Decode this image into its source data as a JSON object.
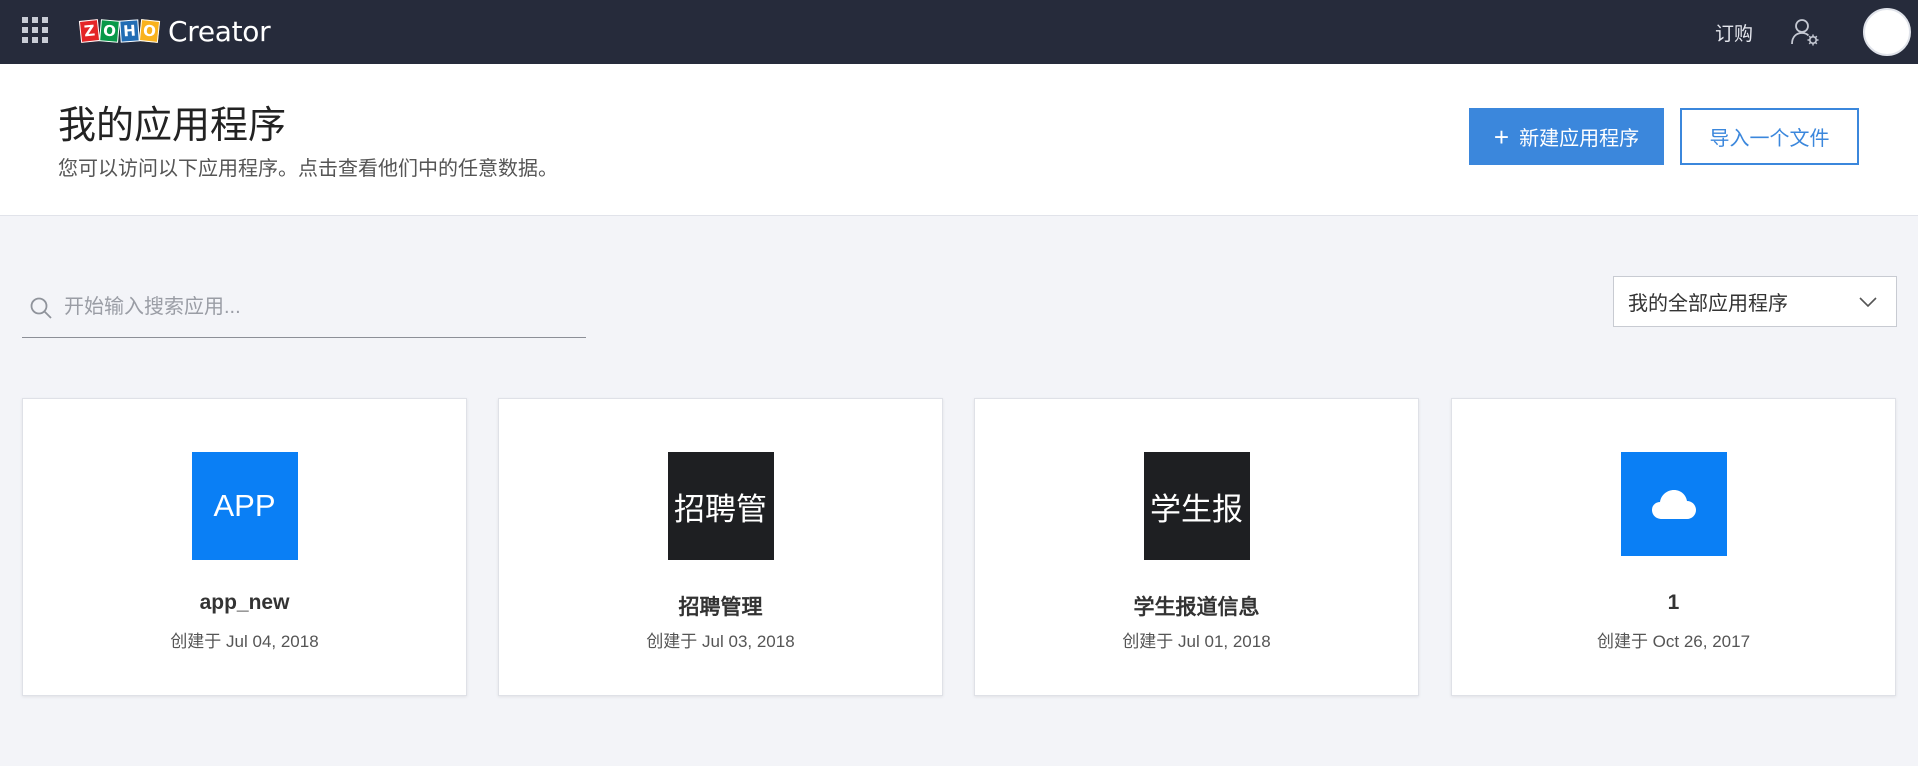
{
  "topbar": {
    "logo_letters": [
      "Z",
      "O",
      "H",
      "O"
    ],
    "logo_colors": [
      "#e42527",
      "#089949",
      "#226db4",
      "#f9b21d"
    ],
    "product_name": "Creator",
    "subscribe_label": "订购",
    "icons": [
      "grid-icon",
      "user-settings-icon",
      "avatar"
    ],
    "background": "#262b3b"
  },
  "header": {
    "title": "我的应用程序",
    "subtitle": "您可以访问以下应用程序。点击查看他们中的任意数据。",
    "new_app_label": "新建应用程序",
    "import_label": "导入一个文件",
    "accent": "#3b87dc"
  },
  "search": {
    "placeholder": "开始输入搜索应用..."
  },
  "filter": {
    "selected": "我的全部应用程序"
  },
  "apps": [
    {
      "name": "app_new",
      "created": "创建于 Jul 04, 2018",
      "icon_text": "APP",
      "icon_bg": "#0a7ff5"
    },
    {
      "name": "招聘管理",
      "created": "创建于 Jul 03, 2018",
      "icon_text": "招聘管",
      "icon_bg": "#1e1f22"
    },
    {
      "name": "学生报道信息",
      "created": "创建于 Jul 01, 2018",
      "icon_text": "学生报",
      "icon_bg": "#1e1f22"
    },
    {
      "name": "1",
      "created": "创建于 Oct 26, 2017",
      "icon_text": "",
      "icon_bg": "#0a7ff5",
      "icon": "cloud-icon"
    }
  ]
}
